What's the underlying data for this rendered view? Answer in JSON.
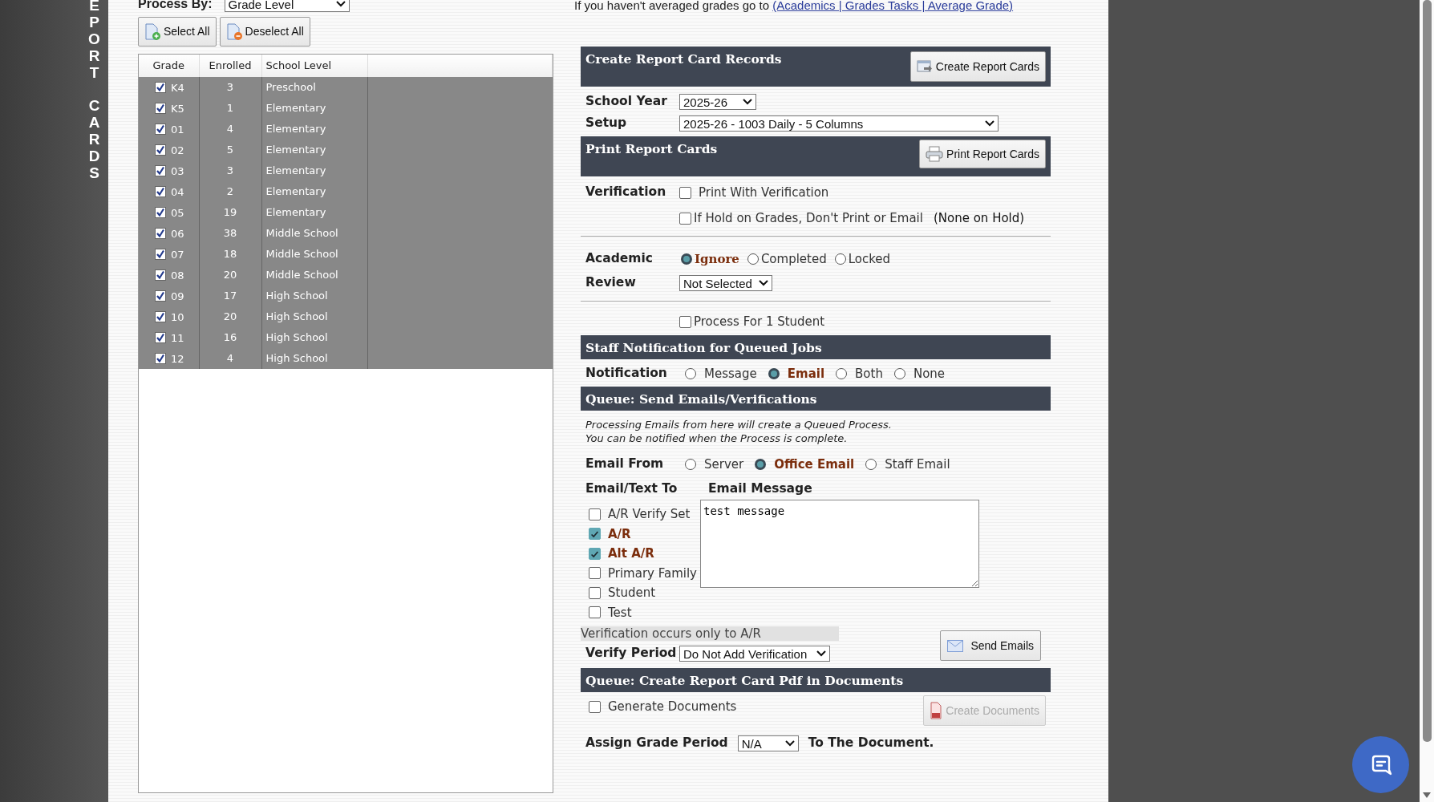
{
  "sidebar_title": "EPORT CARDS",
  "process_by": {
    "label": "Process By:",
    "value": "Grade Level"
  },
  "selection_buttons": [
    {
      "label": "Select All",
      "kind": "add"
    },
    {
      "label": "Deselect All",
      "kind": "remove"
    }
  ],
  "grade_table": {
    "columns": [
      "Grade",
      "Enrolled",
      "School Level"
    ],
    "rows": [
      {
        "grade": "K4",
        "enrolled": "3",
        "school_level": "Preschool",
        "checked": true
      },
      {
        "grade": "K5",
        "enrolled": "1",
        "school_level": "Elementary",
        "checked": true
      },
      {
        "grade": "01",
        "enrolled": "4",
        "school_level": "Elementary",
        "checked": true
      },
      {
        "grade": "02",
        "enrolled": "5",
        "school_level": "Elementary",
        "checked": true
      },
      {
        "grade": "03",
        "enrolled": "3",
        "school_level": "Elementary",
        "checked": true
      },
      {
        "grade": "04",
        "enrolled": "2",
        "school_level": "Elementary",
        "checked": true
      },
      {
        "grade": "05",
        "enrolled": "19",
        "school_level": "Elementary",
        "checked": true
      },
      {
        "grade": "06",
        "enrolled": "38",
        "school_level": "Middle School",
        "checked": true
      },
      {
        "grade": "07",
        "enrolled": "18",
        "school_level": "Middle School",
        "checked": true
      },
      {
        "grade": "08",
        "enrolled": "20",
        "school_level": "Middle School",
        "checked": true
      },
      {
        "grade": "09",
        "enrolled": "17",
        "school_level": "High School",
        "checked": true
      },
      {
        "grade": "10",
        "enrolled": "20",
        "school_level": "High School",
        "checked": true
      },
      {
        "grade": "11",
        "enrolled": "16",
        "school_level": "High School",
        "checked": true
      },
      {
        "grade": "12",
        "enrolled": "4",
        "school_level": "High School",
        "checked": true
      }
    ]
  },
  "averaging_note": {
    "text": "If you haven't averaged grades go to",
    "link": "(Academics | Grades Tasks | Average Grade)"
  },
  "create_section": {
    "title": "Create Report Card Records",
    "button": "Create Report Cards",
    "school_year": {
      "label": "School Year",
      "value": "2025-26"
    },
    "setup": {
      "label": "Setup",
      "value": "2025-26 - 1003 Daily - 5 Columns"
    }
  },
  "print_section": {
    "title": "Print Report Cards",
    "button": "Print Report Cards",
    "verification": {
      "label": "Verification",
      "options": [
        {
          "label": "Print With Verification",
          "checked": false
        },
        {
          "label": "If Hold on Grades, Don't Print or Email",
          "checked": false
        }
      ],
      "hold_status": "(None on Hold)"
    },
    "academic": {
      "label": "Academic",
      "options": [
        {
          "label": "Ignore",
          "selected": true
        },
        {
          "label": "Completed",
          "selected": false
        },
        {
          "label": "Locked",
          "selected": false
        }
      ]
    },
    "review": {
      "label": "Review",
      "value": "Not Selected"
    },
    "single_student": {
      "label": "Process For 1 Student",
      "checked": false
    }
  },
  "notification_section": {
    "title": "Staff Notification for Queued Jobs",
    "label": "Notification",
    "options": [
      {
        "label": "Message",
        "selected": false
      },
      {
        "label": "Email",
        "selected": true
      },
      {
        "label": "Both",
        "selected": false
      },
      {
        "label": "None",
        "selected": false
      }
    ]
  },
  "email_section": {
    "title": "Queue: Send Emails/Verifications",
    "info": [
      "Processing Emails from here will create a Queued Process.",
      "You can be notified when the Process is complete."
    ],
    "email_from": {
      "label": "Email From",
      "options": [
        {
          "label": "Server",
          "selected": false
        },
        {
          "label": "Office Email",
          "selected": true
        },
        {
          "label": "Staff Email",
          "selected": false
        }
      ]
    },
    "recipients_label": "Email/Text To",
    "message_label": "Email Message",
    "recipients": [
      {
        "label": "A/R Verify Set",
        "checked": false
      },
      {
        "label": "A/R",
        "checked": true
      },
      {
        "label": "Alt A/R",
        "checked": true
      },
      {
        "label": "Primary Family",
        "checked": false
      },
      {
        "label": "Student",
        "checked": false
      },
      {
        "label": "Test",
        "checked": false
      }
    ],
    "message": "test message",
    "verification_note": "Verification occurs only to A/R",
    "verify_period": {
      "label": "Verify Period",
      "value": "Do Not Add Verification"
    },
    "button": "Send Emails"
  },
  "pdf_section": {
    "title": "Queue: Create Report Card Pdf in Documents",
    "generate": {
      "label": "Generate Documents",
      "checked": false
    },
    "button": {
      "label": "Create Documents",
      "disabled": true
    },
    "grade_period": {
      "label": "Assign Grade Period",
      "value": "N/A",
      "suffix": "To The Document."
    }
  }
}
